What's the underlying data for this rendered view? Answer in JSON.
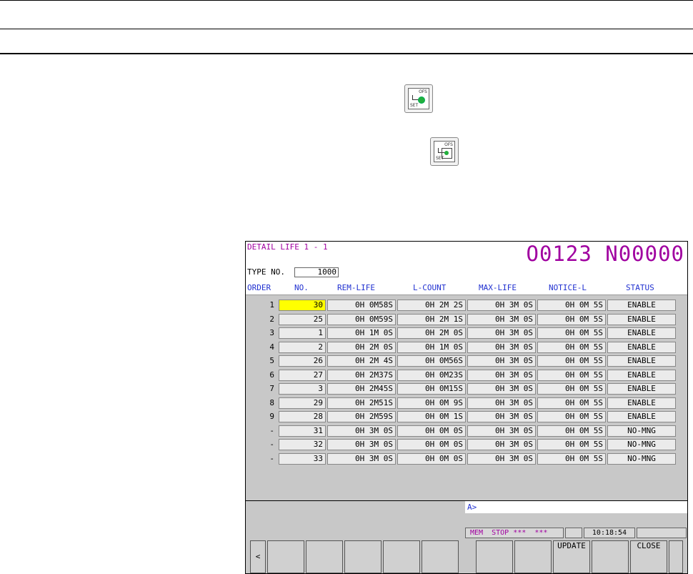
{
  "screen": {
    "title_left": "DETAIL LIFE 1 - 1",
    "title_right": "O0123 N00000",
    "type_no_label": "TYPE NO.",
    "type_no_value": "1000",
    "headers": [
      "ORDER",
      "NO.",
      "REM-LIFE",
      "L-COUNT",
      "MAX-LIFE",
      "NOTICE-L",
      "STATUS"
    ],
    "rows": [
      {
        "order": "1",
        "no": "30",
        "rem": "0H 0M58S",
        "lcount": "0H 2M 2S",
        "max": "0H 3M 0S",
        "notice": "0H 0M 5S",
        "status": "ENABLE"
      },
      {
        "order": "2",
        "no": "25",
        "rem": "0H 0M59S",
        "lcount": "0H 2M 1S",
        "max": "0H 3M 0S",
        "notice": "0H 0M 5S",
        "status": "ENABLE"
      },
      {
        "order": "3",
        "no": "1",
        "rem": "0H 1M 0S",
        "lcount": "0H 2M 0S",
        "max": "0H 3M 0S",
        "notice": "0H 0M 5S",
        "status": "ENABLE"
      },
      {
        "order": "4",
        "no": "2",
        "rem": "0H 2M 0S",
        "lcount": "0H 1M 0S",
        "max": "0H 3M 0S",
        "notice": "0H 0M 5S",
        "status": "ENABLE"
      },
      {
        "order": "5",
        "no": "26",
        "rem": "0H 2M 4S",
        "lcount": "0H 0M56S",
        "max": "0H 3M 0S",
        "notice": "0H 0M 5S",
        "status": "ENABLE"
      },
      {
        "order": "6",
        "no": "27",
        "rem": "0H 2M37S",
        "lcount": "0H 0M23S",
        "max": "0H 3M 0S",
        "notice": "0H 0M 5S",
        "status": "ENABLE"
      },
      {
        "order": "7",
        "no": "3",
        "rem": "0H 2M45S",
        "lcount": "0H 0M15S",
        "max": "0H 3M 0S",
        "notice": "0H 0M 5S",
        "status": "ENABLE"
      },
      {
        "order": "8",
        "no": "29",
        "rem": "0H 2M51S",
        "lcount": "0H 0M 9S",
        "max": "0H 3M 0S",
        "notice": "0H 0M 5S",
        "status": "ENABLE"
      },
      {
        "order": "9",
        "no": "28",
        "rem": "0H 2M59S",
        "lcount": "0H 0M 1S",
        "max": "0H 3M 0S",
        "notice": "0H 0M 5S",
        "status": "ENABLE"
      },
      {
        "order": "-",
        "no": "31",
        "rem": "0H 3M 0S",
        "lcount": "0H 0M 0S",
        "max": "0H 3M 0S",
        "notice": "0H 0M 5S",
        "status": "NO-MNG"
      },
      {
        "order": "-",
        "no": "32",
        "rem": "0H 3M 0S",
        "lcount": "0H 0M 0S",
        "max": "0H 3M 0S",
        "notice": "0H 0M 5S",
        "status": "NO-MNG"
      },
      {
        "order": "-",
        "no": "33",
        "rem": "0H 3M 0S",
        "lcount": "0H 0M 0S",
        "max": "0H 3M 0S",
        "notice": "0H 0M 5S",
        "status": "NO-MNG"
      }
    ],
    "input_prompt": "A>",
    "status": {
      "mode": "MEM",
      "state": "STOP",
      "alarm1": "***",
      "alarm2": "***",
      "time": "10:18:54"
    },
    "softkeys": {
      "left_arrow": "<",
      "update": "UPDATE",
      "close": "CLOSE"
    }
  },
  "icons": {
    "key1": {
      "name": "ofs-set-key-icon",
      "top_label": "OFS",
      "bottom_label": "SET"
    },
    "key2": {
      "name": "ofs-set-key-icon",
      "top_label": "OFS",
      "bottom_label": "SET"
    }
  }
}
